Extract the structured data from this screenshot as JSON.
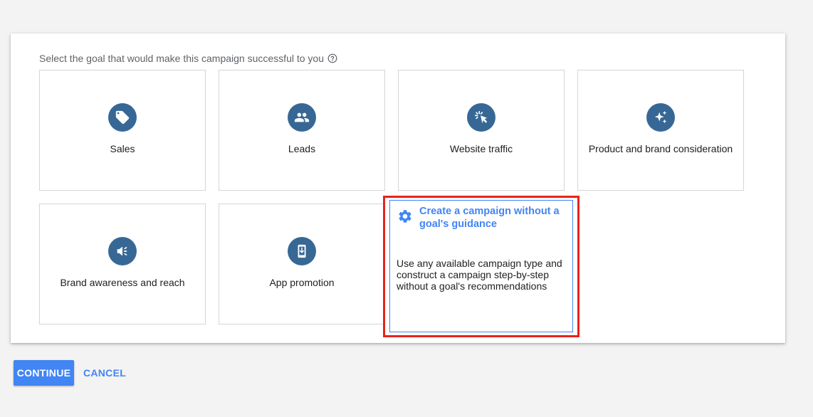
{
  "prompt": {
    "text": "Select the goal that would make this campaign successful to you",
    "help_icon": "help-circle-icon"
  },
  "goals": [
    {
      "label": "Sales",
      "icon": "tag-icon"
    },
    {
      "label": "Leads",
      "icon": "people-icon"
    },
    {
      "label": "Website traffic",
      "icon": "cursor-click-icon"
    },
    {
      "label": "Product and brand consideration",
      "icon": "sparkle-icon"
    },
    {
      "label": "Brand awareness and reach",
      "icon": "megaphone-icon"
    },
    {
      "label": "App promotion",
      "icon": "phone-icon"
    }
  ],
  "no_goal": {
    "title": "Create a campaign without a goal's guidance",
    "description": "Use any available campaign type and construct a campaign step-by-step without a goal's recommendations",
    "icon": "gear-icon",
    "selected": true
  },
  "actions": {
    "continue_label": "CONTINUE",
    "cancel_label": "CANCEL"
  },
  "colors": {
    "accent": "#4285f4",
    "icon_bg": "#376895",
    "highlight": "#e8231b"
  }
}
